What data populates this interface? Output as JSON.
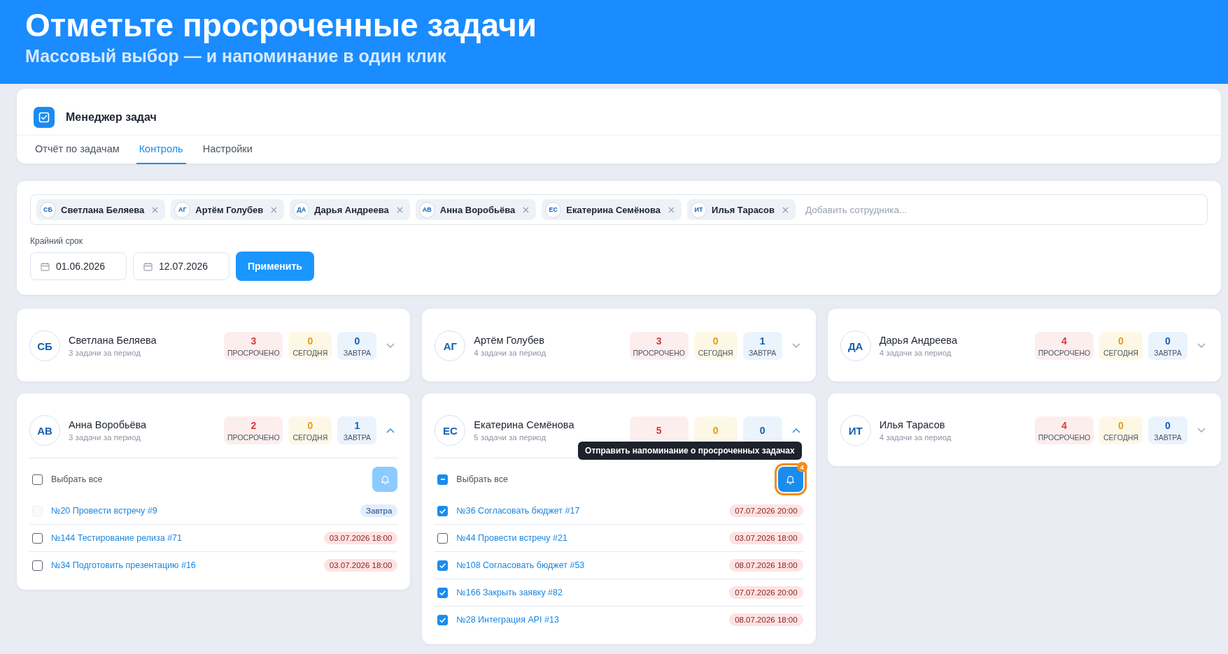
{
  "banner": {
    "title": "Отметьте просроченные задачи",
    "subtitle": "Массовый выбор — и напоминание в один клик"
  },
  "app": {
    "title": "Менеджер задач",
    "tabs": [
      {
        "label": "Отчёт по задачам",
        "selected": false
      },
      {
        "label": "Контроль",
        "selected": true
      },
      {
        "label": "Настройки",
        "selected": false
      }
    ]
  },
  "filter": {
    "employees": [
      {
        "initials": "СБ",
        "name": "Светлана Беляева"
      },
      {
        "initials": "АГ",
        "name": "Артём Голубев"
      },
      {
        "initials": "ДА",
        "name": "Дарья Андреева"
      },
      {
        "initials": "АВ",
        "name": "Анна Воробьёва"
      },
      {
        "initials": "ЕС",
        "name": "Екатерина Семёнова"
      },
      {
        "initials": "ИТ",
        "name": "Илья Тарасов"
      }
    ],
    "employee_placeholder": "Добавить сотрудника...",
    "deadline_label": "Крайний срок",
    "date_from": "01.06.2026",
    "date_to": "12.07.2026",
    "apply_button": "Применить"
  },
  "employees": [
    {
      "initials": "СБ",
      "name": "Светлана Беляева",
      "period": "3 задачи за период",
      "expanded": false,
      "stats": [
        {
          "kind": "overdue",
          "value": "3",
          "label": "ПРОСРОЧЕНО"
        },
        {
          "kind": "today",
          "value": "0",
          "label": "СЕГОДНЯ"
        },
        {
          "kind": "tomorrow",
          "value": "0",
          "label": "ЗАВТРА"
        }
      ]
    },
    {
      "initials": "АГ",
      "name": "Артём Голубев",
      "period": "4 задачи за период",
      "expanded": false,
      "stats": [
        {
          "kind": "overdue",
          "value": "3",
          "label": "ПРОСРОЧЕНО"
        },
        {
          "kind": "today",
          "value": "0",
          "label": "СЕГОДНЯ"
        },
        {
          "kind": "tomorrow",
          "value": "1",
          "label": "ЗАВТРА"
        }
      ]
    },
    {
      "initials": "ДА",
      "name": "Дарья Андреева",
      "period": "4 задачи за период",
      "expanded": false,
      "stats": [
        {
          "kind": "overdue",
          "value": "4",
          "label": "ПРОСРОЧЕНО"
        },
        {
          "kind": "today",
          "value": "0",
          "label": "СЕГОДНЯ"
        },
        {
          "kind": "tomorrow",
          "value": "0",
          "label": "ЗАВТРА"
        }
      ]
    },
    {
      "initials": "АВ",
      "name": "Анна Воробьёва",
      "period": "3 задачи за период",
      "expanded": true,
      "stats": [
        {
          "kind": "overdue",
          "value": "2",
          "label": "ПРОСРОЧЕНО"
        },
        {
          "kind": "today",
          "value": "0",
          "label": "СЕГОДНЯ"
        },
        {
          "kind": "tomorrow",
          "value": "1",
          "label": "ЗАВТРА"
        }
      ],
      "select_all": {
        "label": "Выбрать все",
        "partial": false
      },
      "bell": {
        "disabled": true,
        "focused": false
      },
      "tasks": [
        {
          "title": "№20 Провести встречу #9",
          "checked": false,
          "disabled": true,
          "overdue": false,
          "due": "Завтра"
        },
        {
          "title": "№144 Тестирование релиза #71",
          "checked": false,
          "disabled": false,
          "overdue": true,
          "due": "03.07.2026 18:00"
        },
        {
          "title": "№34 Подготовить презентацию #16",
          "checked": false,
          "disabled": false,
          "overdue": true,
          "due": "03.07.2026 18:00"
        }
      ]
    },
    {
      "initials": "ЕС",
      "name": "Екатерина Семёнова",
      "period": "5 задачи за период",
      "expanded": true,
      "stats": [
        {
          "kind": "overdue",
          "value": "5"
        },
        {
          "kind": "today",
          "value": "0"
        },
        {
          "kind": "tomorrow",
          "value": "0"
        }
      ],
      "select_all": {
        "label": "Выбрать все",
        "partial": true
      },
      "bell": {
        "disabled": false,
        "focused": true,
        "badge": "4",
        "tooltip": "Отправить напоминание о просроченных задачах"
      },
      "tasks": [
        {
          "title": "№36 Согласовать бюджет #17",
          "checked": true,
          "disabled": false,
          "overdue": true,
          "due": "07.07.2026 20:00"
        },
        {
          "title": "№44 Провести встречу #21",
          "checked": false,
          "disabled": false,
          "overdue": true,
          "due": "03.07.2026 18:00"
        },
        {
          "title": "№108 Согласовать бюджет #53",
          "checked": true,
          "disabled": false,
          "overdue": true,
          "due": "08.07.2026 18:00"
        },
        {
          "title": "№166 Закрыть заявку #82",
          "checked": true,
          "disabled": false,
          "overdue": true,
          "due": "07.07.2026 20:00"
        },
        {
          "title": "№28 Интеграция API #13",
          "checked": true,
          "disabled": false,
          "overdue": true,
          "due": "08.07.2026 18:00"
        }
      ]
    },
    {
      "initials": "ИТ",
      "name": "Илья Тарасов",
      "period": "4 задачи за период",
      "expanded": false,
      "stats": [
        {
          "kind": "overdue",
          "value": "4",
          "label": "ПРОСРОЧЕНО"
        },
        {
          "kind": "today",
          "value": "0",
          "label": "СЕГОДНЯ"
        },
        {
          "kind": "tomorrow",
          "value": "0",
          "label": "ЗАВТРА"
        }
      ]
    }
  ]
}
